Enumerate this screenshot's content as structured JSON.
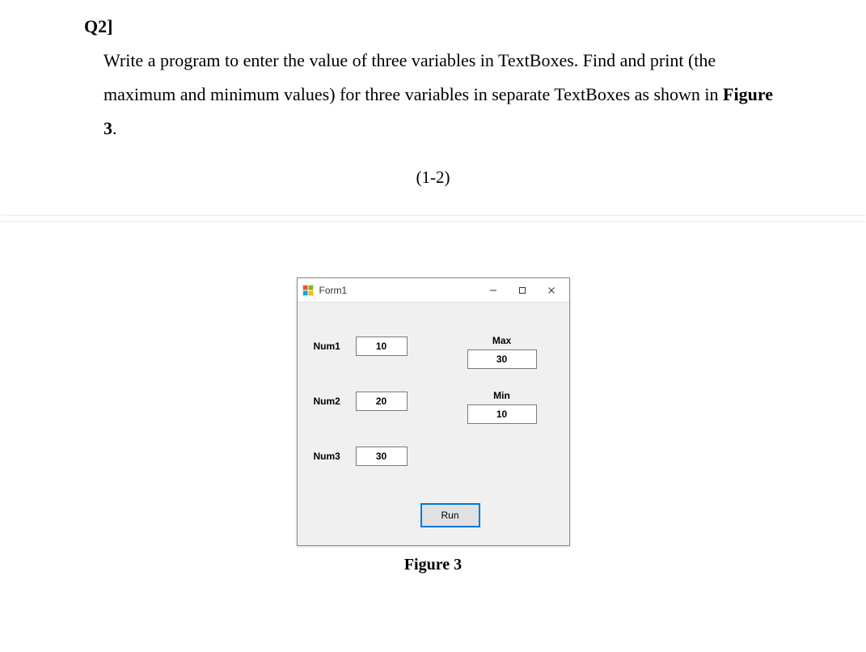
{
  "question": {
    "header": "Q2]",
    "body_prefix": "Write a program to enter the value of three variables in TextBoxes. Find and print (the maximum and minimum values) for three variables in separate TextBoxes as shown in ",
    "figref": "Figure 3",
    "body_suffix": "."
  },
  "page_mark": "(1-2)",
  "window": {
    "title": "Form1"
  },
  "form": {
    "num1_label": "Num1",
    "num1_value": "10",
    "num2_label": "Num2",
    "num2_value": "20",
    "num3_label": "Num3",
    "num3_value": "30",
    "max_label": "Max",
    "max_value": "30",
    "min_label": "Min",
    "min_value": "10",
    "run_label": "Run"
  },
  "caption": "Figure 3"
}
